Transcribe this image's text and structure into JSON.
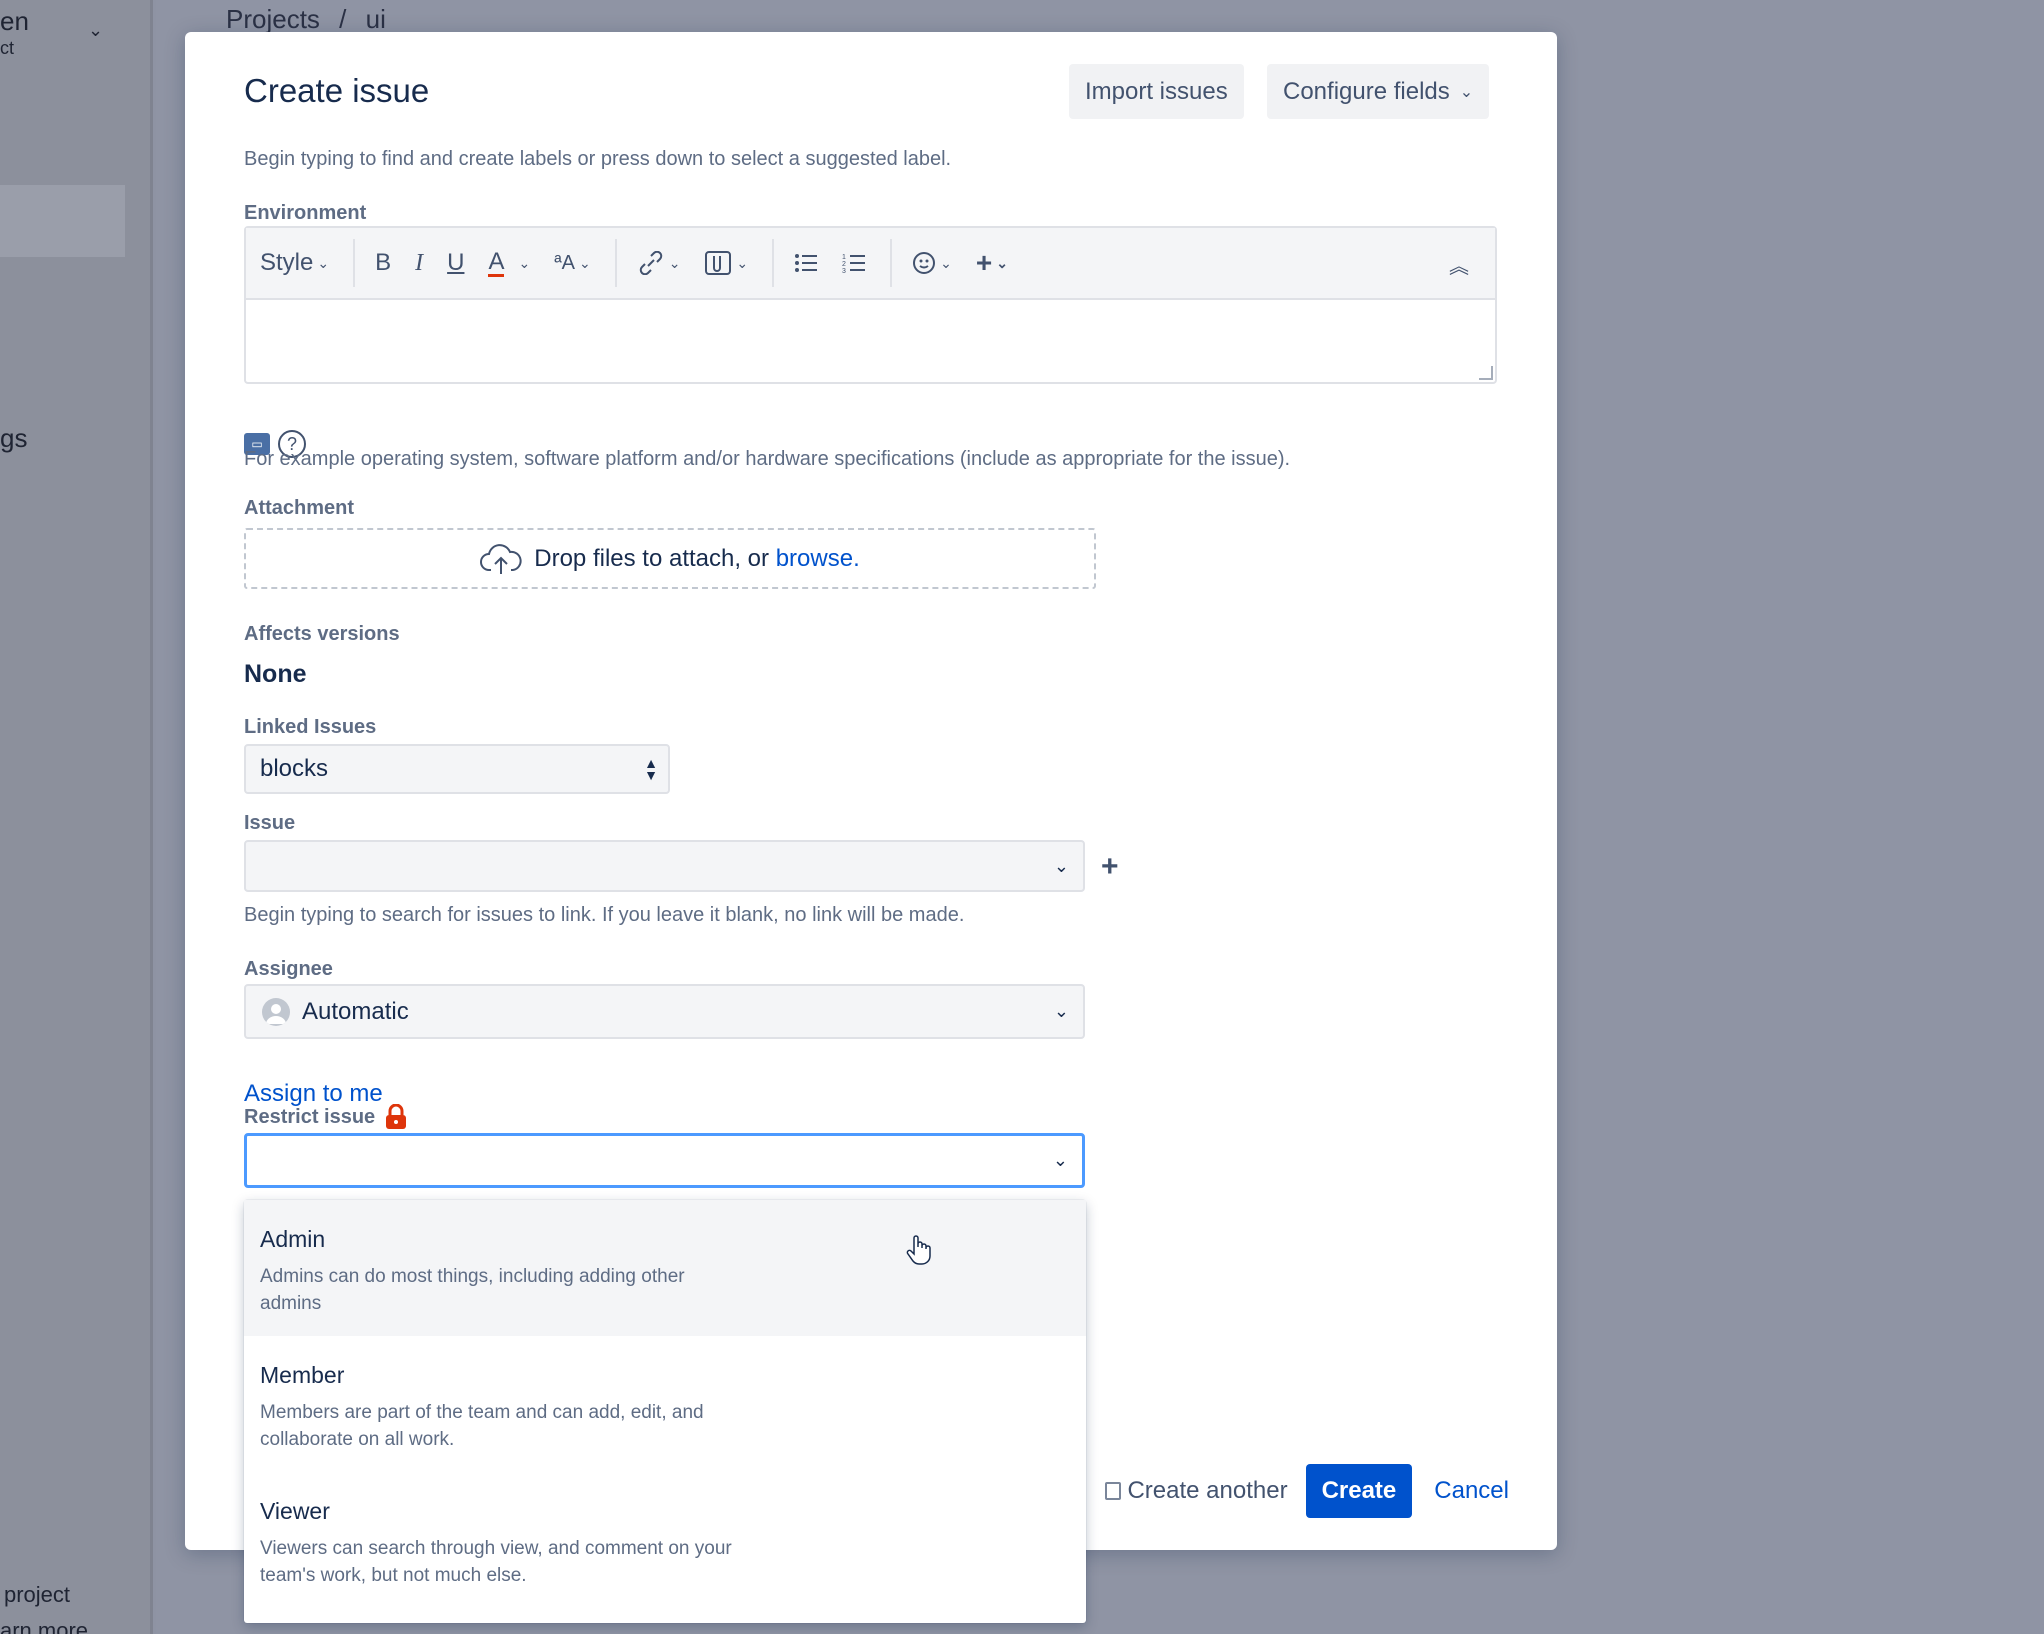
{
  "background": {
    "sidebar_title_fragment": "en",
    "sidebar_subtitle_fragment": "ct",
    "sidebar_item_fragment": "gs",
    "sidebar_footer_1": "project",
    "sidebar_footer_2": "arn more",
    "breadcrumb": [
      "Projects",
      "/",
      "ui"
    ]
  },
  "modal": {
    "title": "Create issue",
    "import_label": "Import issues",
    "configure_label": "Configure fields",
    "labels_hint": "Begin typing to find and create labels or press down to select a suggested label.",
    "environment": {
      "label": "Environment",
      "toolbar": {
        "style": "Style",
        "bold": "B",
        "italic": "I",
        "underline": "U",
        "text_color": "A",
        "more_format": "ªA"
      },
      "help_icon_text": "?",
      "hint": "For example operating system, software platform and/or hardware specifications (include as appropriate for the issue)."
    },
    "attachment": {
      "label": "Attachment",
      "drop_text": "Drop files to attach, or ",
      "browse": "browse."
    },
    "affects_versions": {
      "label": "Affects versions",
      "value": "None"
    },
    "linked_issues": {
      "label": "Linked Issues",
      "value": "blocks"
    },
    "issue": {
      "label": "Issue",
      "value": "",
      "hint": "Begin typing to search for issues to link. If you leave it blank, no link will be made."
    },
    "assignee": {
      "label": "Assignee",
      "value": "Automatic",
      "assign_to_me": "Assign to me"
    },
    "restrict": {
      "label": "Restrict issue",
      "value": "",
      "options": [
        {
          "title": "Admin",
          "description": "Admins can do most things, including adding other admins"
        },
        {
          "title": "Member",
          "description": "Members are part of the team and can add, edit, and collaborate on all work."
        },
        {
          "title": "Viewer",
          "description": "Viewers can search through view, and comment on your team's work, but not much else."
        }
      ]
    },
    "footer": {
      "create_another": "Create another",
      "create": "Create",
      "cancel": "Cancel"
    }
  },
  "colors": {
    "primary": "#0052cc",
    "focus": "#4c9aff",
    "lock": "#de350b",
    "overlay": "#8e93a3"
  }
}
